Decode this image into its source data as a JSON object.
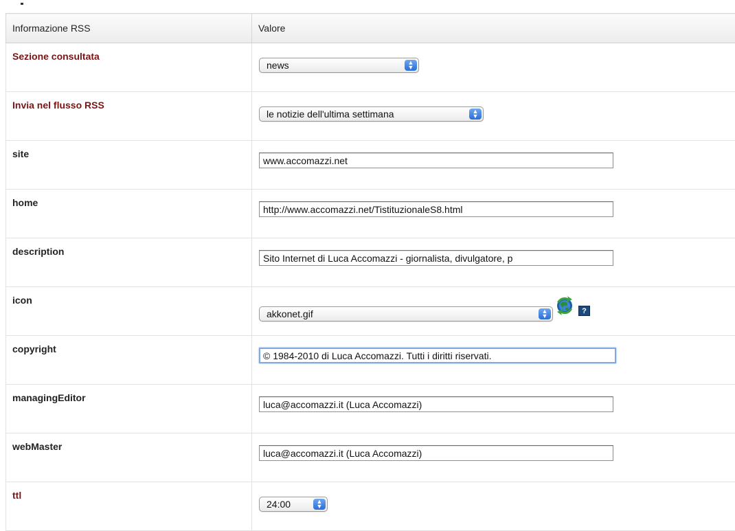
{
  "table": {
    "header": {
      "col1": "Informazione RSS",
      "col2": "Valore"
    },
    "rows": [
      {
        "label": "Sezione consultata",
        "kind": "select",
        "value": "news",
        "required": true
      },
      {
        "label": "Invia nel flusso RSS",
        "kind": "select",
        "value": "le notizie dell'ultima settimana",
        "required": true
      },
      {
        "label": "site",
        "kind": "input",
        "value": "www.accomazzi.net",
        "required": false
      },
      {
        "label": "home",
        "kind": "input",
        "value": "http://www.accomazzi.net/TistituzionaleS8.html",
        "required": false
      },
      {
        "label": "description",
        "kind": "input",
        "value": "Sito Internet di Luca Accomazzi - giornalista, divulgatore, p",
        "required": false
      },
      {
        "label": "icon",
        "kind": "select",
        "value": "akkonet.gif",
        "required": false
      },
      {
        "label": "copyright",
        "kind": "input",
        "value": "© 1984-2010 di Luca Accomazzi. Tutti i diritti riservati.",
        "required": false,
        "focused": true
      },
      {
        "label": "managingEditor",
        "kind": "input",
        "value": "luca@accomazzi.it (Luca Accomazzi)",
        "required": false
      },
      {
        "label": "webMaster",
        "kind": "input",
        "value": "luca@accomazzi.it (Luca Accomazzi)",
        "required": false
      },
      {
        "label": "ttl",
        "kind": "select",
        "value": "24:00",
        "required": true
      }
    ]
  },
  "icons": {
    "refresh": "refresh-globe-icon",
    "help": "help-icon",
    "help_glyph": "?"
  },
  "colors": {
    "required_label": "#7a1414",
    "focus_ring": "#7faadf",
    "select_arrows": "#2a6fd8"
  }
}
